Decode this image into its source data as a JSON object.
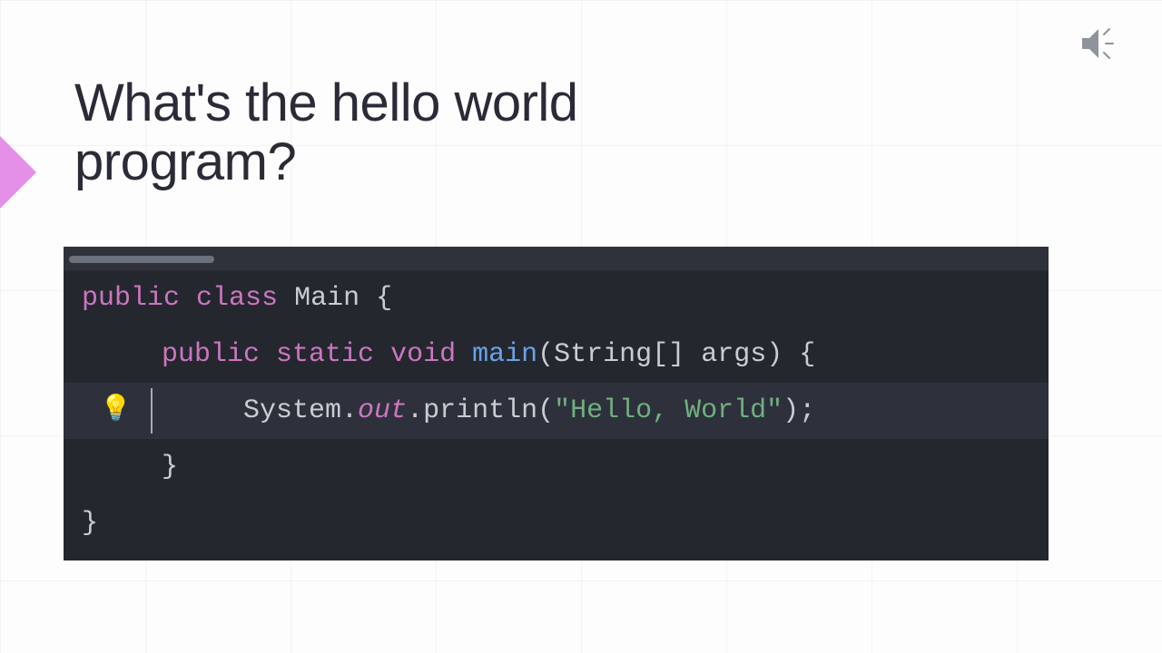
{
  "title": "What's the hello world program?",
  "icons": {
    "speaker": "speaker-icon",
    "arrow": "arrow-icon",
    "bulb": "💡"
  },
  "code": {
    "tokens": {
      "l1_kw1": "public",
      "l1_kw2": "class",
      "l1_name": "Main",
      "l1_brace": "{",
      "l2_kw1": "public",
      "l2_kw2": "static",
      "l2_kw3": "void",
      "l2_method": "main",
      "l2_sig_open": "(",
      "l2_type": "String",
      "l2_brackets": "[]",
      "l2_param": "args",
      "l2_sig_close": ")",
      "l2_brace": "{",
      "l3_obj": "System",
      "l3_dot1": ".",
      "l3_field": "out",
      "l3_dot2": ".",
      "l3_call": "println",
      "l3_open": "(",
      "l3_str": "\"Hello, World\"",
      "l3_close": ")",
      "l3_semi": ";",
      "l4_brace": "}",
      "l5_brace": "}"
    }
  }
}
